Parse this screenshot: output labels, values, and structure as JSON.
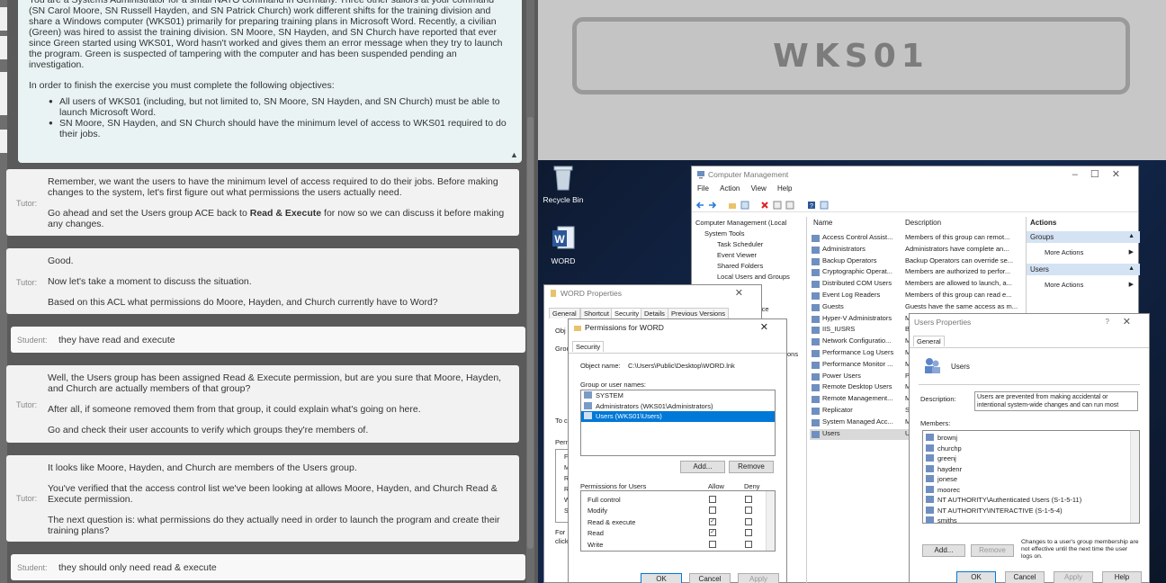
{
  "intro": {
    "para1": "You are a Systems Administrator for a small NATO command in Germany. Three other sailors at your command (SN Carol Moore, SN Russell Hayden, and SN Patrick Church) work different shifts for the training division and share a Windows computer (WKS01) primarily for preparing training plans in Microsoft Word. Recently, a civilian (Green) was hired to assist the training division. SN Moore, SN Hayden, and SN Church have reported that ever since Green started using WKS01, Word hasn't worked and gives them an error message when they try to launch the program. Green is suspected of tampering with the computer and has been suspended pending an investigation.",
    "para2": "In order to finish the exercise you must complete the following objectives:",
    "objectives": [
      "All users of WKS01 (including, but not limited to, SN Moore, SN Hayden, and SN Church) must be able to launch Microsoft Word.",
      "SN Moore, SN Hayden, and SN Church should have the minimum level of access to WKS01 required to do their jobs."
    ],
    "scroll_up": "▲"
  },
  "messages": [
    {
      "who": "Tutor:",
      "p": [
        "Remember, we want the users to have the minimum level of access required to do their jobs. Before making changes to the system, let's first figure out what permissions the users actually need.",
        "Go ahead and set the Users group ACE back to Read & Execute for now so we can discuss it before making any changes."
      ]
    },
    {
      "who": "Tutor:",
      "p": [
        "Good.",
        "Now let's take a moment to discuss the situation.",
        "Based on this ACL what permissions do Moore, Hayden, and Church currently have to Word?"
      ]
    },
    {
      "who": "Student:",
      "text": "they have read and execute"
    },
    {
      "who": "Tutor:",
      "p": [
        "Well, the Users group has been assigned Read & Execute permission, but are you sure that Moore, Hayden, and Church are actually members of that group?",
        "After all, if someone removed them from that group, it could explain what's going on here.",
        "Go and check their user accounts to verify which groups they're members of."
      ]
    },
    {
      "who": "Tutor:",
      "p": [
        "It looks like Moore, Hayden, and Church are members of the Users group.",
        "You've verified that the access control list we've been looking at allows Moore, Hayden, and Church Read & Execute permission.",
        "The next question is: what permissions do they actually need in order to launch the program and create their training plans?"
      ]
    },
    {
      "who": "Student:",
      "text": "they should only need read & execute"
    }
  ],
  "vm": {
    "name": "WKS01"
  },
  "desktop": {
    "icons": [
      "Recycle Bin",
      "WORD"
    ]
  },
  "cm": {
    "title": "Computer Management",
    "menu": [
      "File",
      "Action",
      "View",
      "Help"
    ],
    "tree": [
      "Computer Management (Local",
      "System Tools",
      "Task Scheduler",
      "Event Viewer",
      "Shared Folders",
      "Local Users and Groups",
      "ice",
      "ons"
    ],
    "columns": [
      "Name",
      "Description"
    ],
    "groups": [
      {
        "name": "Access Control Assist...",
        "desc": "Members of this group can remot..."
      },
      {
        "name": "Administrators",
        "desc": "Administrators have complete an..."
      },
      {
        "name": "Backup Operators",
        "desc": "Backup Operators can override se..."
      },
      {
        "name": "Cryptographic Operat...",
        "desc": "Members are authorized to perfor..."
      },
      {
        "name": "Distributed COM Users",
        "desc": "Members are allowed to launch, a..."
      },
      {
        "name": "Event Log Readers",
        "desc": "Members of this group can read e..."
      },
      {
        "name": "Guests",
        "desc": "Guests have the same access as m..."
      },
      {
        "name": "Hyper-V Administrators",
        "desc": "M"
      },
      {
        "name": "IIS_IUSRS",
        "desc": "B"
      },
      {
        "name": "Network Configuratio...",
        "desc": "M"
      },
      {
        "name": "Performance Log Users",
        "desc": "M"
      },
      {
        "name": "Performance Monitor ...",
        "desc": "M"
      },
      {
        "name": "Power Users",
        "desc": "P"
      },
      {
        "name": "Remote Desktop Users",
        "desc": "M"
      },
      {
        "name": "Remote Management...",
        "desc": "M"
      },
      {
        "name": "Replicator",
        "desc": "S"
      },
      {
        "name": "System Managed Acc...",
        "desc": "M"
      },
      {
        "name": "Users",
        "desc": "U"
      }
    ],
    "actions_title": "Actions",
    "action_groups": [
      "Groups",
      "More Actions",
      "Users",
      "More Actions"
    ]
  },
  "wp": {
    "title": "WORD Properties",
    "tabs": [
      "General",
      "Shortcut",
      "Security",
      "Details",
      "Previous Versions"
    ],
    "frag": [
      "Obj",
      "Grou",
      "To c",
      "Perm",
      "F",
      "M",
      "R",
      "R",
      "W",
      "S",
      "For",
      "click"
    ]
  },
  "perm": {
    "title": "Permissions for WORD",
    "tab": "Security",
    "object_label": "Object name:",
    "object_value": "C:\\Users\\Public\\Desktop\\WORD.lnk",
    "group_label": "Group or user names:",
    "names": [
      "SYSTEM",
      "Administrators (WKS01\\Administrators)",
      "Users (WKS01\\Users)"
    ],
    "add": "Add...",
    "remove": "Remove",
    "perm_label": "Permissions for Users",
    "allow": "Allow",
    "deny": "Deny",
    "perms": [
      {
        "name": "Full control",
        "allow": false,
        "deny": false
      },
      {
        "name": "Modify",
        "allow": false,
        "deny": false
      },
      {
        "name": "Read & execute",
        "allow": true,
        "deny": false
      },
      {
        "name": "Read",
        "allow": true,
        "deny": false
      },
      {
        "name": "Write",
        "allow": false,
        "deny": false
      }
    ],
    "ok": "OK",
    "cancel": "Cancel",
    "apply": "Apply"
  },
  "up": {
    "title": "Users Properties",
    "help": "?",
    "tab": "General",
    "name": "Users",
    "desc_label": "Description:",
    "desc_value": "Users are prevented from making accidental or intentional system-wide changes and can run most",
    "members_label": "Members:",
    "members": [
      "brownj",
      "churchp",
      "greenj",
      "haydenr",
      "jonese",
      "moorec",
      "NT AUTHORITY\\Authenticated Users (S-1-5-11)",
      "NT AUTHORITY\\INTERACTIVE (S-1-5-4)",
      "smiths"
    ],
    "add": "Add...",
    "remove": "Remove",
    "note": "Changes to a user's group membership are not effective until the next time the user logs on.",
    "ok": "OK",
    "cancel": "Cancel",
    "apply": "Apply",
    "help_btn": "Help"
  }
}
